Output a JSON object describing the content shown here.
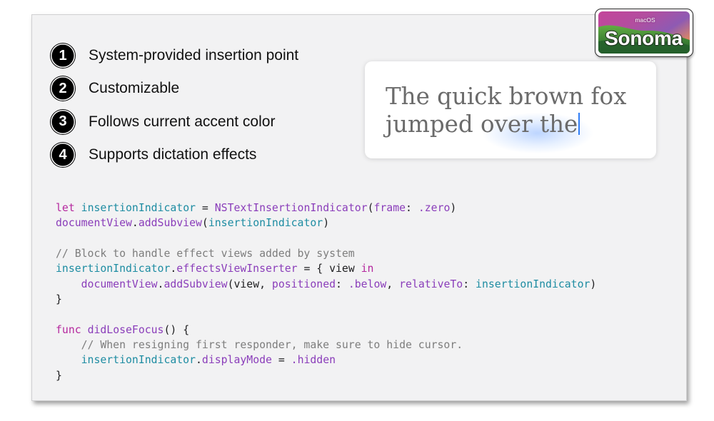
{
  "badge": {
    "os_label": "macOS",
    "name": "Sonoma"
  },
  "features": [
    {
      "number": "1",
      "label": "System-provided insertion point"
    },
    {
      "number": "2",
      "label": "Customizable"
    },
    {
      "number": "3",
      "label": "Follows current accent color"
    },
    {
      "number": "4",
      "label": "Supports dictation effects"
    }
  ],
  "text_preview": {
    "lines": [
      "The quick brown fox",
      "jumped over the"
    ],
    "text_color": "#6b6b6b",
    "cursor_color": "#2f7df6"
  },
  "code": {
    "syntax_colors": {
      "keyword": "#b5289e",
      "identifier": "#1d8ca2",
      "symbol": "#8a3dba",
      "comment": "#7d7d7d",
      "plain": "#1d1d1f"
    },
    "lines": [
      {
        "tokens": [
          {
            "text": "let",
            "style": "keyword"
          },
          {
            "text": " ",
            "style": "plain"
          },
          {
            "text": "insertionIndicator",
            "style": "identifier"
          },
          {
            "text": " = ",
            "style": "plain"
          },
          {
            "text": "NSTextInsertionIndicator",
            "style": "symbol"
          },
          {
            "text": "(",
            "style": "plain"
          },
          {
            "text": "frame",
            "style": "symbol"
          },
          {
            "text": ": ",
            "style": "plain"
          },
          {
            "text": ".zero",
            "style": "symbol"
          },
          {
            "text": ")",
            "style": "plain"
          }
        ]
      },
      {
        "tokens": [
          {
            "text": "documentView",
            "style": "symbol"
          },
          {
            "text": ".",
            "style": "plain"
          },
          {
            "text": "addSubview",
            "style": "symbol"
          },
          {
            "text": "(",
            "style": "plain"
          },
          {
            "text": "insertionIndicator",
            "style": "identifier"
          },
          {
            "text": ")",
            "style": "plain"
          }
        ]
      },
      {
        "tokens": []
      },
      {
        "tokens": [
          {
            "text": "// Block to handle effect views added by system",
            "style": "comment"
          }
        ]
      },
      {
        "tokens": [
          {
            "text": "insertionIndicator",
            "style": "identifier"
          },
          {
            "text": ".",
            "style": "plain"
          },
          {
            "text": "effectsViewInserter",
            "style": "symbol"
          },
          {
            "text": " = { view ",
            "style": "plain"
          },
          {
            "text": "in",
            "style": "keyword"
          }
        ]
      },
      {
        "tokens": [
          {
            "text": "    ",
            "style": "plain"
          },
          {
            "text": "documentView",
            "style": "symbol"
          },
          {
            "text": ".",
            "style": "plain"
          },
          {
            "text": "addSubview",
            "style": "symbol"
          },
          {
            "text": "(view, ",
            "style": "plain"
          },
          {
            "text": "positioned",
            "style": "symbol"
          },
          {
            "text": ": ",
            "style": "plain"
          },
          {
            "text": ".below",
            "style": "symbol"
          },
          {
            "text": ", ",
            "style": "plain"
          },
          {
            "text": "relativeTo",
            "style": "symbol"
          },
          {
            "text": ": ",
            "style": "plain"
          },
          {
            "text": "insertionIndicator",
            "style": "identifier"
          },
          {
            "text": ")",
            "style": "plain"
          }
        ]
      },
      {
        "tokens": [
          {
            "text": "}",
            "style": "plain"
          }
        ]
      },
      {
        "tokens": []
      },
      {
        "tokens": [
          {
            "text": "func",
            "style": "keyword"
          },
          {
            "text": " ",
            "style": "plain"
          },
          {
            "text": "didLoseFocus",
            "style": "symbol"
          },
          {
            "text": "() {",
            "style": "plain"
          }
        ]
      },
      {
        "tokens": [
          {
            "text": "    ",
            "style": "plain"
          },
          {
            "text": "// When resigning first responder, make sure to hide cursor.",
            "style": "comment"
          }
        ]
      },
      {
        "tokens": [
          {
            "text": "    ",
            "style": "plain"
          },
          {
            "text": "insertionIndicator",
            "style": "identifier"
          },
          {
            "text": ".",
            "style": "plain"
          },
          {
            "text": "displayMode",
            "style": "symbol"
          },
          {
            "text": " = ",
            "style": "plain"
          },
          {
            "text": ".hidden",
            "style": "symbol"
          }
        ]
      },
      {
        "tokens": [
          {
            "text": "}",
            "style": "plain"
          }
        ]
      }
    ]
  }
}
